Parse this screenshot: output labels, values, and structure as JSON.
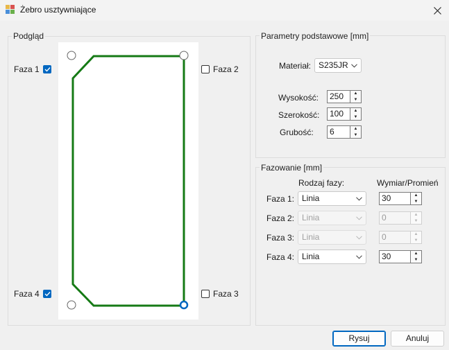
{
  "window": {
    "title": "Żebro usztywniające"
  },
  "preview": {
    "legend": "Podgląd",
    "faza1": {
      "label": "Faza 1",
      "checked": true
    },
    "faza2": {
      "label": "Faza 2",
      "checked": false
    },
    "faza3": {
      "label": "Faza 3",
      "checked": false
    },
    "faza4": {
      "label": "Faza 4",
      "checked": true
    },
    "shape_color": "#157a15",
    "selected_corner_color": "#0067c0"
  },
  "params": {
    "legend": "Parametry podstawowe [mm]",
    "material_label": "Materiał:",
    "material_value": "S235JR",
    "height_label": "Wysokość:",
    "height_value": "250",
    "width_label": "Szerokość:",
    "width_value": "100",
    "thickness_label": "Grubość:",
    "thickness_value": "6"
  },
  "chamfer": {
    "legend": "Fazowanie [mm]",
    "type_header": "Rodzaj fazy:",
    "size_header": "Wymiar/Promień",
    "rows": [
      {
        "label": "Faza 1:",
        "type": "Linia",
        "value": "30",
        "enabled": true
      },
      {
        "label": "Faza 2:",
        "type": "Linia",
        "value": "0",
        "enabled": false
      },
      {
        "label": "Faza 3:",
        "type": "Linia",
        "value": "0",
        "enabled": false
      },
      {
        "label": "Faza 4:",
        "type": "Linia",
        "value": "30",
        "enabled": true
      }
    ]
  },
  "buttons": {
    "draw": "Rysuj",
    "cancel": "Anuluj"
  }
}
